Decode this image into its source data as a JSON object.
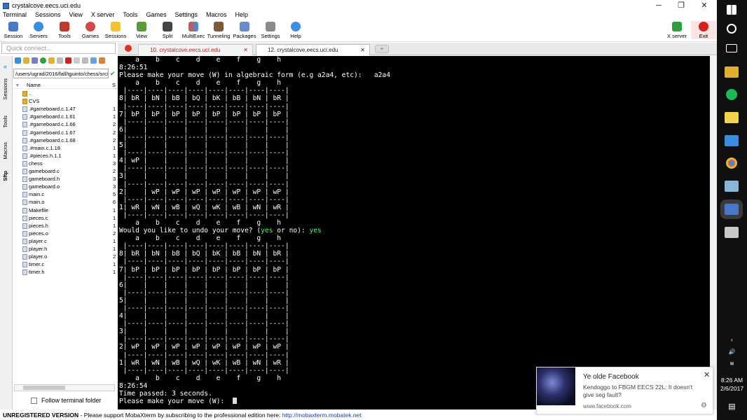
{
  "window": {
    "title": "crystalcove.eecs.uci.edu",
    "controls": [
      "─",
      "❐",
      "✕"
    ]
  },
  "menu": [
    "Terminal",
    "Sessions",
    "View",
    "X server",
    "Tools",
    "Games",
    "Settings",
    "Macros",
    "Help"
  ],
  "toolbar": {
    "buttons": [
      "Session",
      "Servers",
      "Tools",
      "Games",
      "Sessions",
      "View",
      "Split",
      "MultiExec",
      "Tunneling",
      "Packages",
      "Settings",
      "Help"
    ],
    "right": [
      "X server",
      "Exit"
    ]
  },
  "quick_connect": {
    "placeholder": "Quick connect..."
  },
  "tabs": [
    {
      "label": "10. crystalcove.eecs.uci.edu",
      "close": "✕"
    },
    {
      "label": "12. crystalcove.eecs.uci.edu",
      "close": "✕"
    }
  ],
  "side_tabs": [
    "Sessions",
    "Tools",
    "Macros",
    "Sftp"
  ],
  "sidebar": {
    "path": "/users/ugrad/2016/fall/tguinto/chess/src/",
    "columns": {
      "name": "Name",
      "size": "S"
    },
    "files": [
      {
        "name": "..",
        "size": ""
      },
      {
        "name": "CVS",
        "size": ""
      },
      {
        "name": ".#gameboard.c.1.47",
        "size": "1"
      },
      {
        "name": ".#gameboard.c.1.61",
        "size": "1"
      },
      {
        "name": ".#gameboard.c.1.66",
        "size": "2"
      },
      {
        "name": ".#gameboard.c.1.67",
        "size": "2"
      },
      {
        "name": ".#gameboard.c.1.68",
        "size": "2"
      },
      {
        "name": ".#main.c.1.18",
        "size": "1"
      },
      {
        "name": ".#pieces.h.1.1",
        "size": "1"
      },
      {
        "name": "chess",
        "size": "3"
      },
      {
        "name": "gameboard.c",
        "size": "2"
      },
      {
        "name": "gameboard.h",
        "size": "3"
      },
      {
        "name": "gameboard.o",
        "size": "3"
      },
      {
        "name": "main.c",
        "size": "5"
      },
      {
        "name": "main.o",
        "size": "6"
      },
      {
        "name": "Makefile",
        "size": "1"
      },
      {
        "name": "pieces.c",
        "size": "1"
      },
      {
        "name": "pieces.h",
        "size": "1"
      },
      {
        "name": "pieces.o",
        "size": "2"
      },
      {
        "name": "player.c",
        "size": "1"
      },
      {
        "name": "player.h",
        "size": "1"
      },
      {
        "name": "player.o",
        "size": "2"
      },
      {
        "name": "timer.c",
        "size": "1"
      },
      {
        "name": "timer.h",
        "size": "1"
      }
    ],
    "follow_label": "Follow terminal folder"
  },
  "terminal": {
    "lines": [
      "    a    b    c    d    e    f    g    h",
      "8:26:51",
      "Please make your move (W) in algebraic form (e.g a2a4, etc):   a2a4",
      "    a    b    c    d    e    f    g    h",
      " |----|----|----|----|----|----|----|----|",
      "8| bR | bN | bB | bQ | bK | bB | bN | bR |",
      " |----|----|----|----|----|----|----|----|",
      "7| bP | bP | bP | bP | bP | bP | bP | bP |",
      " |----|----|----|----|----|----|----|----|",
      "6|    |    |    |    |    |    |    |    |",
      " |----|----|----|----|----|----|----|----|",
      "5|    |    |    |    |    |    |    |    |",
      " |----|----|----|----|----|----|----|----|",
      "4| wP |    |    |    |    |    |    |    |",
      " |----|----|----|----|----|----|----|----|",
      "3|    |    |    |    |    |    |    |    |",
      " |----|----|----|----|----|----|----|----|",
      "2|    | wP | wP | wP | wP | wP | wP | wP |",
      " |----|----|----|----|----|----|----|----|",
      "1| wR | wN | wB | wQ | wK | wB | wN | wR |",
      " |----|----|----|----|----|----|----|----|",
      "    a    b    c    d    e    f    g    h"
    ],
    "undo_prompt": "Would you like to undo your move? (",
    "undo_yes": "yes",
    "undo_or": " or no): ",
    "undo_answer": "yes",
    "lines2": [
      "    a    b    c    d    e    f    g    h",
      " |----|----|----|----|----|----|----|----|",
      "8| bR | bN | bB | bQ | bK | bB | bN | bR |",
      " |----|----|----|----|----|----|----|----|",
      "7| bP | bP | bP | bP | bP | bP | bP | bP |",
      " |----|----|----|----|----|----|----|----|",
      "6|    |    |    |    |    |    |    |    |",
      " |----|----|----|----|----|----|----|----|",
      "5|    |    |    |    |    |    |    |    |",
      " |----|----|----|----|----|----|----|----|",
      "4|    |    |    |    |    |    |    |    |",
      " |----|----|----|----|----|----|----|----|",
      "3|    |    |    |    |    |    |    |    |",
      " |----|----|----|----|----|----|----|----|",
      "2| wP | wP | wP | wP | wP | wP | wP | wP |",
      " |----|----|----|----|----|----|----|----|",
      "1| wR | wN | wB | wQ | wK | wB | wN | wR |",
      " |----|----|----|----|----|----|----|----|",
      "    a    b    c    d    e    f    g    h",
      "8:26:54",
      "Time passed: 3 seconds."
    ],
    "final_prompt": "Please make your move (W):  "
  },
  "status": {
    "unregistered": "UNREGISTERED VERSION",
    "text": " -  Please support MobaXterm by subscribing to the professional edition here: ",
    "link": "http://mobaxterm.mobatek.net"
  },
  "notification": {
    "title": "Ye olde Facebook",
    "body": "Kendoggo to FBGM EECS 22L: It doesn't give seg fault?",
    "url": "www.facebook.com",
    "close": "✕",
    "gear": "⚙"
  },
  "taskbar": {
    "time": "8:26 AM",
    "date": "2/6/2017"
  }
}
